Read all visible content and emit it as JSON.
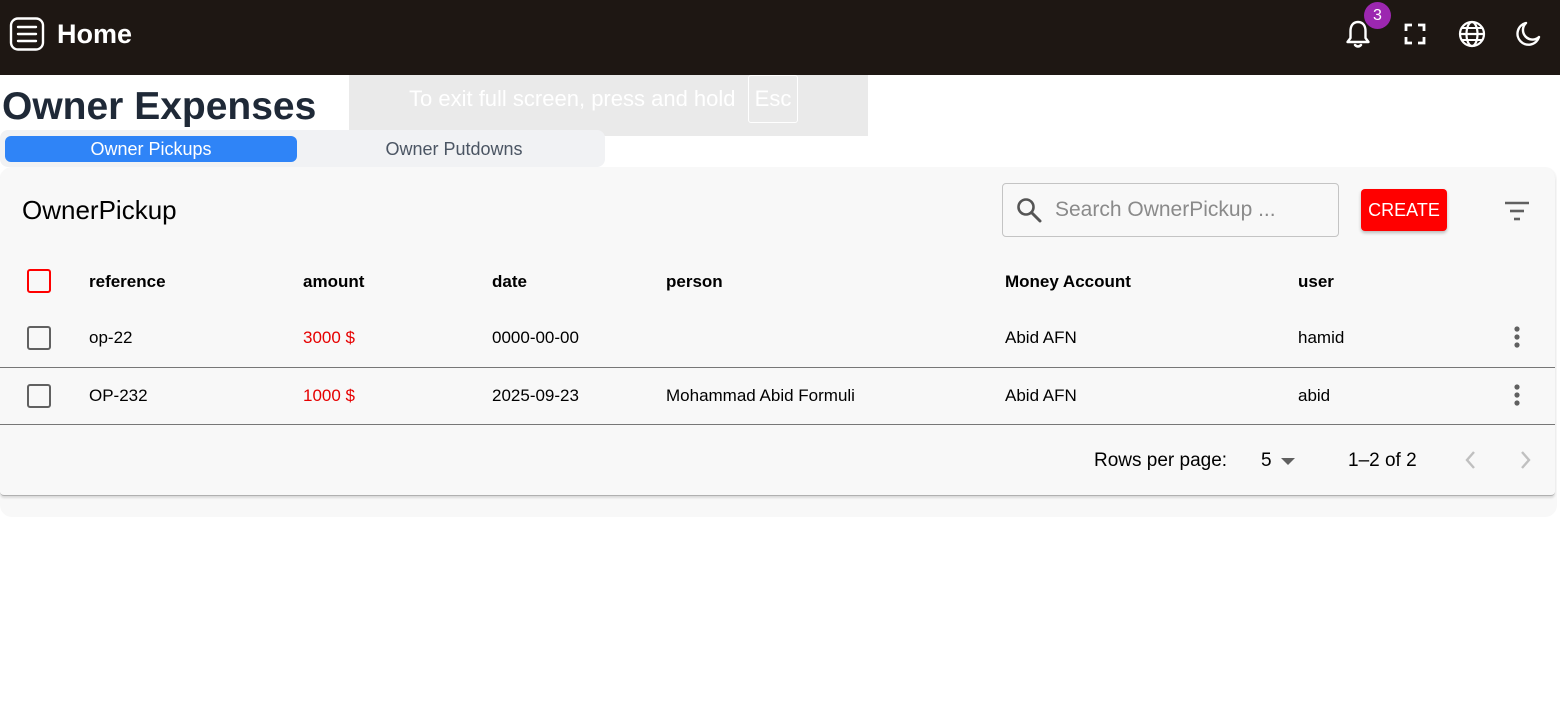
{
  "appbar": {
    "title": "Home",
    "menu_icon": "menu-icon",
    "notifications": {
      "icon": "bell-icon",
      "count": "3",
      "badge_color": "#9c27b0"
    },
    "actions": [
      "fullscreen-icon",
      "globe-icon",
      "moon-icon"
    ],
    "background": "#1e1713"
  },
  "fullscreen_notice": {
    "text": "To exit full screen, press and hold",
    "key": "Esc"
  },
  "page": {
    "title": "Owner Expenses"
  },
  "tabs": [
    {
      "label": "Owner Pickups",
      "active": true
    },
    {
      "label": "Owner Putdowns",
      "active": false
    }
  ],
  "table": {
    "title": "OwnerPickup",
    "search_placeholder": "Search OwnerPickup ...",
    "create_label": "CREATE",
    "columns": [
      "reference",
      "amount",
      "date",
      "person",
      "Money Account",
      "user"
    ],
    "rows": [
      {
        "reference": "op-22",
        "amount": "3000 $",
        "date": "0000-00-00",
        "person": "",
        "money_account": "Abid AFN",
        "user": "hamid"
      },
      {
        "reference": "OP-232",
        "amount": "1000 $",
        "date": "2025-09-23",
        "person": "Mohammad Abid Formuli",
        "money_account": "Abid AFN",
        "user": "abid"
      }
    ]
  },
  "pagination": {
    "rows_per_page_label": "Rows per page:",
    "rows_per_page": "5",
    "range": "1–2 of 2"
  },
  "colors": {
    "accent": "#2f84f7",
    "create": "#ff0000",
    "amount": "#e60000"
  }
}
